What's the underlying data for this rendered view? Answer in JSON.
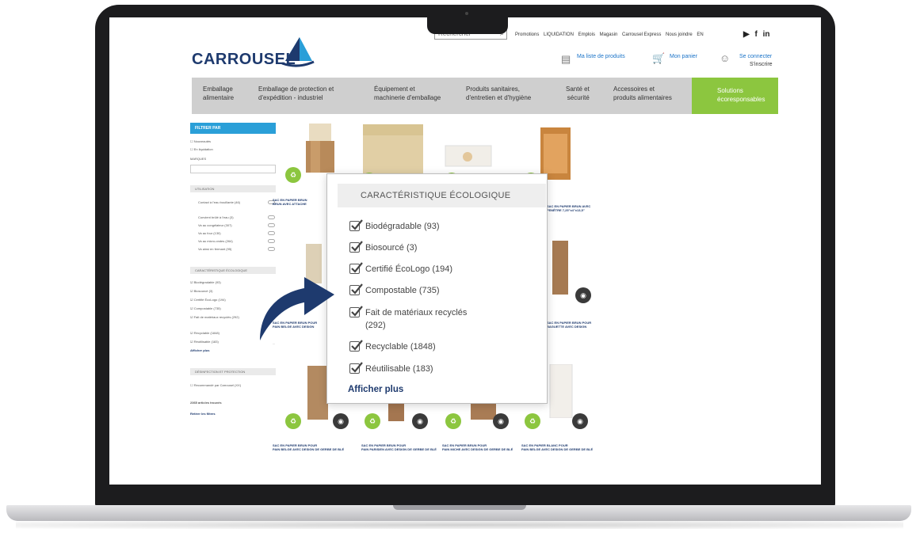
{
  "header": {
    "search_placeholder": "Rechercher",
    "top_links": [
      "Promotions",
      "LIQUIDATION",
      "Emplois",
      "Magasin",
      "Carrousel Express",
      "Nous joindre",
      "EN"
    ],
    "social": [
      "▶",
      "f",
      "in"
    ],
    "logo_text": "CARROUSEL",
    "wishlist_label": "Ma liste de produits",
    "cart_label": "Mon panier",
    "login_label": "Se connecter",
    "signup_label": "S'inscrire"
  },
  "nav": {
    "items": [
      [
        "Emballage",
        "alimentaire"
      ],
      [
        "Emballage de protection et",
        "d'expédition - industriel"
      ],
      [
        "Équipement et",
        "machinerie d'emballage"
      ],
      [
        "Produits sanitaires,",
        "d'entretien et d'hygiène"
      ],
      [
        "Santé et",
        "sécurité"
      ],
      [
        "Accessoires et",
        "produits alimentaires"
      ]
    ],
    "highlight": [
      "Solutions",
      "écoresponsables"
    ]
  },
  "sidebar": {
    "filter_title": "FILTRER PAR",
    "checks": [
      "Nouveautés",
      "En liquidation"
    ],
    "brand_label": "MARQUES",
    "usage_title": "UTILISATION",
    "usage_items": [
      "Contact à l'eau bouillante (46)",
      "Convient brûlé à l'eau (3)",
      "Va au congélateur (307)",
      "Va au four (130)",
      "Va au micro-ondes (264)",
      "Va ainsi en fermant (95)"
    ],
    "eco_title": "CARACTÉRISTIQUE ÉCOLOGIQUE",
    "eco_items": [
      "Biodégradable (93)",
      "Biosourcé (3)",
      "Certifié ÉcoLogo (194)",
      "Compostable (735)",
      "Fait de matériaux recyclés (292)",
      "Recyclable (1848)",
      "Réutilisable (183)"
    ],
    "more": "Afficher plus",
    "protection_title": "DÉSINFECTION ET PROTECTION",
    "protection_item": "Recommandé par Carrousel (XX)",
    "results": "2365 articles trouvés",
    "reset": "Retirer les filtres"
  },
  "popup": {
    "title": "CARACTÉRISTIQUE ÉCOLOGIQUE",
    "options": [
      {
        "label": "Biodégradable (93)",
        "checked": true
      },
      {
        "label": "Biosourcé (3)",
        "checked": true
      },
      {
        "label": "Certifié ÉcoLogo (194)",
        "checked": true
      },
      {
        "label": "Compostable (735)",
        "checked": true
      },
      {
        "label": "Fait de matériaux recyclés",
        "label2": "(292)",
        "checked": true
      },
      {
        "label": "Recyclable (1848)",
        "checked": true
      },
      {
        "label": "Réutilisable (183)",
        "checked": true
      }
    ],
    "more": "Afficher plus"
  },
  "products": [
    {
      "title": "SAC EN PAPIER BRUN",
      "title2": "BRUN AVEC ATTACHE"
    },
    {
      "title": "SAC EN PAPIER BRUN AVEC",
      "title2": "FENÊTRE 7,25\"x4\"x13,5\""
    },
    {
      "title": "SAC EN PAPIER BRUN POUR",
      "title2": "PAIN BELGE AVEC DESIGN"
    },
    {
      "title": "SAC EN PAPIER BRUN POUR",
      "title2": "BAGUETTE AVEC DESIGN"
    },
    {
      "title": "SAC EN PAPIER BRUN POUR",
      "title2": "PAIN BELGE AVEC DESIGN DE GERBE DE BLÉ"
    },
    {
      "title": "SAC EN PAPIER BRUN POUR",
      "title2": "PAIN PARISIEN AVEC DESIGN DE GERBE DE BLÉ"
    },
    {
      "title": "SAC EN PAPIER BRUN POUR",
      "title2": "PAIN MICHE AVEC DESIGN DE GERBE DE BLÉ"
    },
    {
      "title": "SAC EN PAPIER BLANC POUR",
      "title2": "PAIN BELGE AVEC DESIGN DE GERBE DE BLÉ"
    }
  ],
  "colors": {
    "brand_blue": "#1e3a6e",
    "accent_blue": "#2a9fd8",
    "eco_green": "#8cc63f",
    "nav_gray": "#cfcfcf"
  }
}
